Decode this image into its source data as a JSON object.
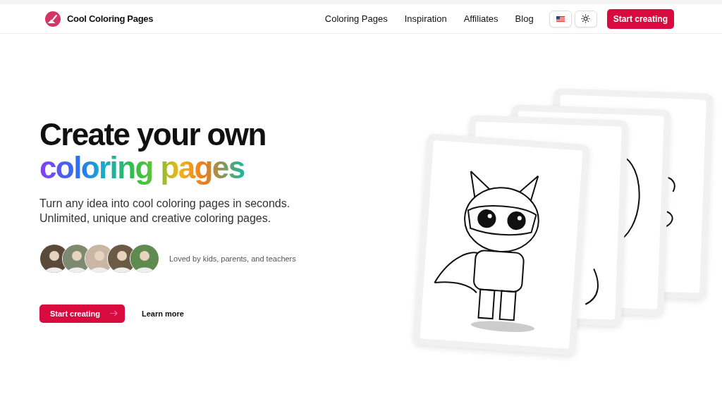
{
  "header": {
    "brand": "Cool Coloring Pages",
    "nav": [
      "Coloring Pages",
      "Inspiration",
      "Affiliates",
      "Blog"
    ],
    "cta": "Start creating"
  },
  "hero": {
    "title_line1": "Create your own",
    "title_line2": "coloring pages",
    "subtitle_line1": "Turn any idea into cool coloring pages in seconds.",
    "subtitle_line2": "Unlimited, unique and creative coloring pages.",
    "social_proof": "Loved by kids, parents, and teachers",
    "primary_button": "Start creating",
    "secondary_button": "Learn more"
  }
}
